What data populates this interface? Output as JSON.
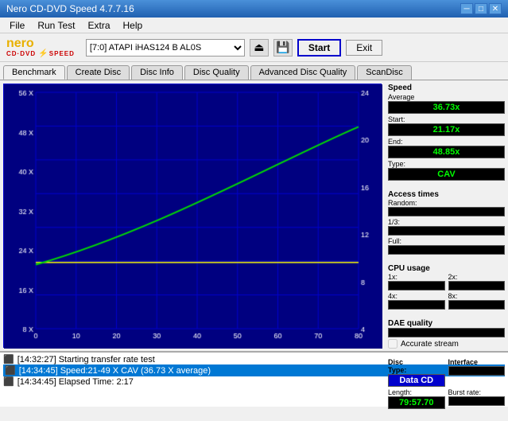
{
  "titleBar": {
    "title": "Nero CD-DVD Speed 4.7.7.16",
    "minimizeLabel": "─",
    "maximizeLabel": "□",
    "closeLabel": "✕"
  },
  "menuBar": {
    "items": [
      "File",
      "Run Test",
      "Extra",
      "Help"
    ]
  },
  "toolbar": {
    "driveSelect": "[7:0]  ATAPI iHAS124  B AL0S",
    "startLabel": "Start",
    "exitLabel": "Exit"
  },
  "tabs": {
    "items": [
      "Benchmark",
      "Create Disc",
      "Disc Info",
      "Disc Quality",
      "Advanced Disc Quality",
      "ScanDisc"
    ],
    "activeIndex": 0
  },
  "speedPanel": {
    "speedLabel": "Speed",
    "averageLabel": "Average",
    "averageValue": "36.73x",
    "startLabel": "Start:",
    "startValue": "21.17x",
    "endLabel": "End:",
    "endValue": "48.85x",
    "typeLabel": "Type:",
    "typeValue": "CAV"
  },
  "accessTimesPanel": {
    "label": "Access times",
    "randomLabel": "Random:",
    "randomValue": "",
    "oneThirdLabel": "1/3:",
    "oneThirdValue": "",
    "fullLabel": "Full:",
    "fullValue": ""
  },
  "cpuPanel": {
    "label": "CPU usage",
    "val1x": "",
    "val2x": "",
    "val4x": "",
    "val8x": ""
  },
  "daePanel": {
    "label": "DAE quality",
    "value": "",
    "accurateStreamLabel": "Accurate stream"
  },
  "discPanel": {
    "typeLabel": "Disc",
    "typeSub": "Type:",
    "typeValue": "Data CD",
    "lengthLabel": "Length:",
    "lengthValue": "79:57.70"
  },
  "interfacePanel": {
    "label": "Interface",
    "burstLabel": "Burst rate:",
    "burstValue": ""
  },
  "logLines": [
    {
      "text": "[14:32:27]  Starting transfer rate test",
      "selected": false
    },
    {
      "text": "[14:34:45]  Speed:21-49 X CAV (36.73 X average)",
      "selected": true
    },
    {
      "text": "[14:34:45]  Elapsed Time: 2:17",
      "selected": false
    }
  ],
  "chart": {
    "xLabels": [
      "0",
      "10",
      "20",
      "30",
      "40",
      "50",
      "60",
      "70",
      "80"
    ],
    "yLeftLabels": [
      "8 X",
      "16 X",
      "24 X",
      "32 X",
      "40 X",
      "48 X",
      "56 X"
    ],
    "yRightLabels": [
      "4",
      "8",
      "12",
      "16",
      "20",
      "24"
    ],
    "lineColor": "#00ff00",
    "refLineColor": "#ffff00"
  }
}
